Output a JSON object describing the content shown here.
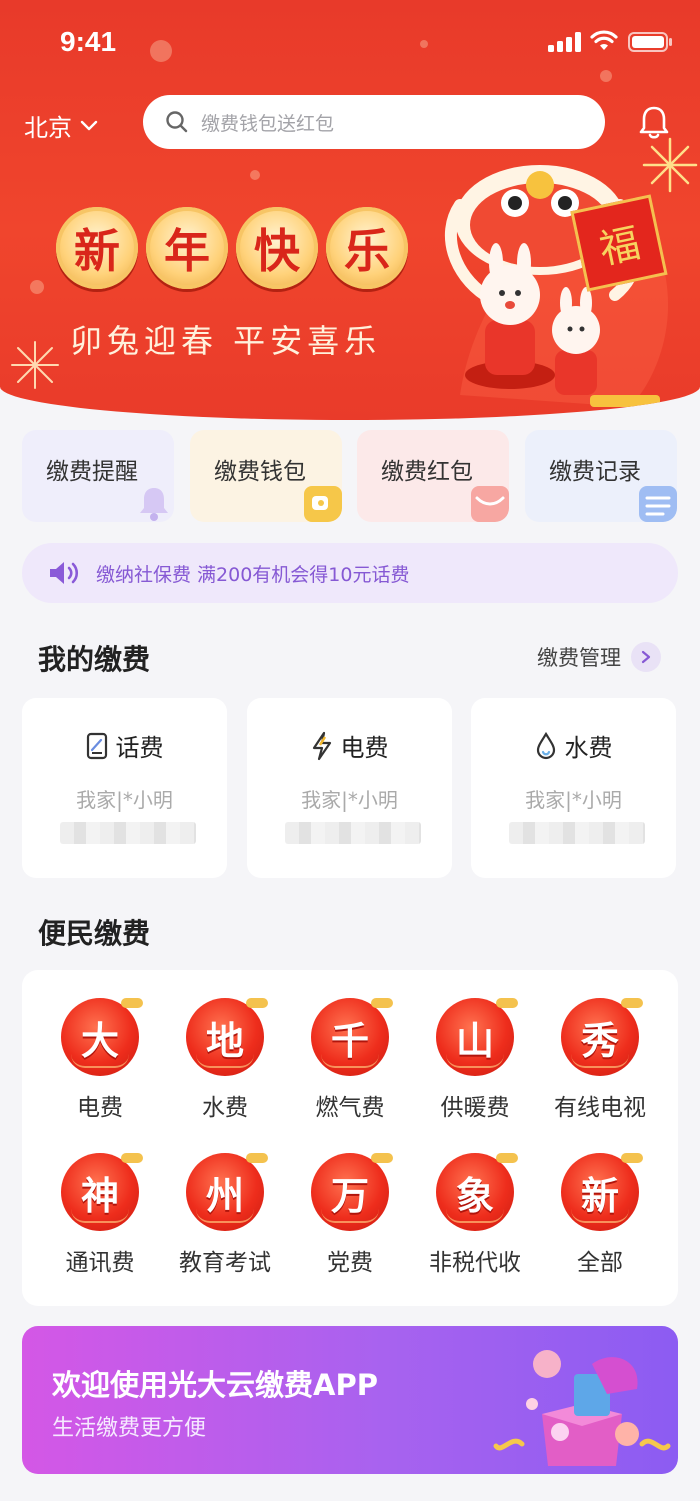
{
  "status_bar": {
    "time": "9:41"
  },
  "header": {
    "city": "北京",
    "search_placeholder": "缴费钱包送红包"
  },
  "hero": {
    "title_chars": [
      "新",
      "年",
      "快",
      "乐"
    ],
    "subtitle": "卯兔迎春 平安喜乐",
    "fu_char": "福"
  },
  "quick_actions": [
    {
      "label": "缴费提醒",
      "bg": "#efeefb",
      "accent": "#c9b7f2",
      "icon": "bell-icon"
    },
    {
      "label": "缴费钱包",
      "bg": "#fcf3e3",
      "accent": "#f5c447",
      "icon": "wallet-icon"
    },
    {
      "label": "缴费红包",
      "bg": "#fce9e9",
      "accent": "#f58a86",
      "icon": "red-envelope-icon"
    },
    {
      "label": "缴费记录",
      "bg": "#ecf0fb",
      "accent": "#93b6f2",
      "icon": "record-icon"
    }
  ],
  "notice": {
    "text": "缴纳社保费 满200有机会得10元话费"
  },
  "my_bills": {
    "title": "我的缴费",
    "manage_label": "缴费管理",
    "cards": [
      {
        "label": "话费",
        "sub": "我家|*小明",
        "icon": "phone-bill-icon"
      },
      {
        "label": "电费",
        "sub": "我家|*小明",
        "icon": "lightning-icon"
      },
      {
        "label": "水费",
        "sub": "我家|*小明",
        "icon": "water-drop-icon"
      }
    ]
  },
  "services": {
    "title": "便民缴费",
    "items": [
      {
        "char": "大",
        "label": "电费"
      },
      {
        "char": "地",
        "label": "水费"
      },
      {
        "char": "千",
        "label": "燃气费"
      },
      {
        "char": "山",
        "label": "供暖费"
      },
      {
        "char": "秀",
        "label": "有线电视"
      },
      {
        "char": "神",
        "label": "通讯费"
      },
      {
        "char": "州",
        "label": "教育考试"
      },
      {
        "char": "万",
        "label": "党费"
      },
      {
        "char": "象",
        "label": "非税代收"
      },
      {
        "char": "新",
        "label": "全部"
      }
    ]
  },
  "banner": {
    "title": "欢迎使用光大云缴费APP",
    "subtitle": "生活缴费更方便"
  },
  "colors": {
    "primary_red": "#ea3c2a",
    "accent_purple": "#8659d4"
  }
}
